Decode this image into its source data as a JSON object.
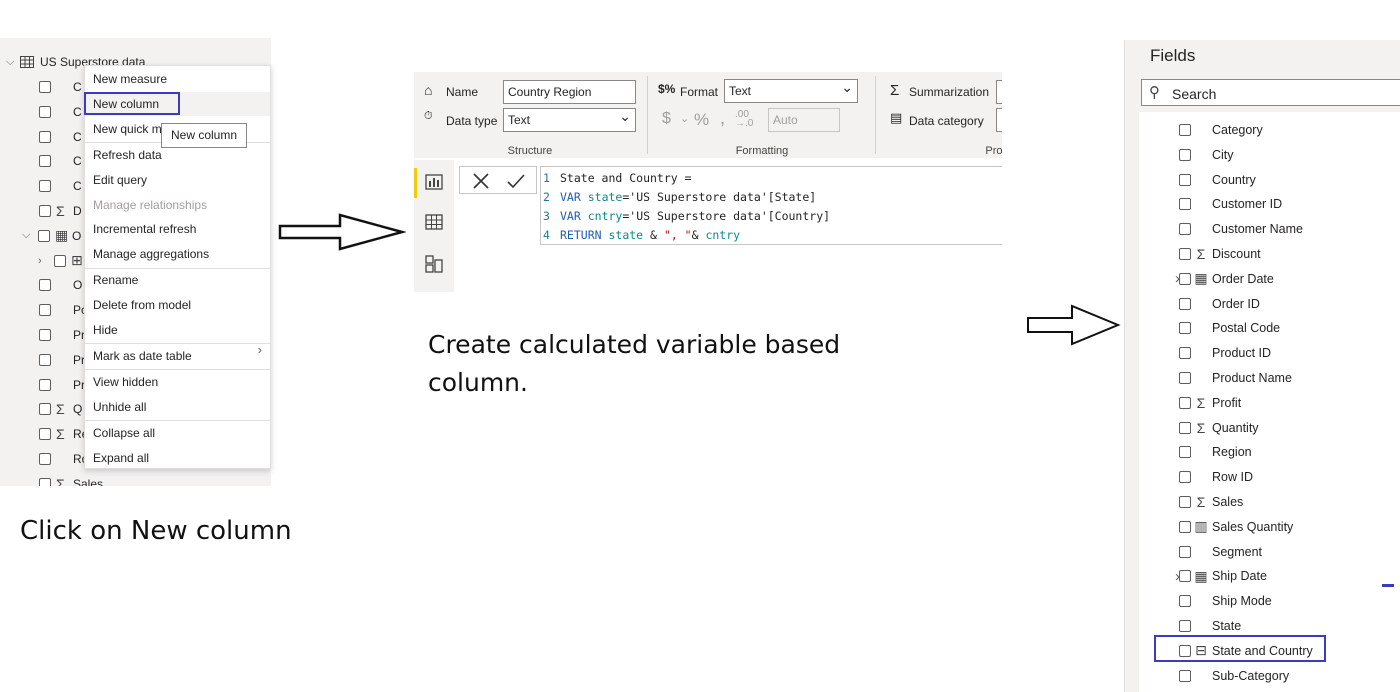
{
  "left_panel": {
    "table_name": "US Superstore data",
    "truncated_rows": [
      "C",
      "C",
      "C",
      "C",
      "C",
      "D",
      "O",
      "",
      "O",
      "Po",
      "Pr",
      "Pr",
      "Pr",
      "Q",
      "Re",
      "Ro",
      "Sales"
    ],
    "context_menu": {
      "items": [
        {
          "label": "New measure",
          "disabled": false
        },
        {
          "label": "New column",
          "disabled": false
        },
        {
          "label": "New quick m",
          "disabled": false
        },
        {
          "label": "Refresh data",
          "disabled": false
        },
        {
          "label": "Edit query",
          "disabled": false
        },
        {
          "label": "Manage relationships",
          "disabled": true
        },
        {
          "label": "Incremental refresh",
          "disabled": false
        },
        {
          "label": "Manage aggregations",
          "disabled": false
        },
        {
          "label": "Rename",
          "disabled": false
        },
        {
          "label": "Delete from model",
          "disabled": false
        },
        {
          "label": "Hide",
          "disabled": false
        },
        {
          "label": "Mark as date table",
          "disabled": false
        },
        {
          "label": "View hidden",
          "disabled": false
        },
        {
          "label": "Unhide all",
          "disabled": false
        },
        {
          "label": "Collapse all",
          "disabled": false
        },
        {
          "label": "Expand all",
          "disabled": false
        }
      ],
      "tooltip": "New column"
    },
    "caption": "Click on New column"
  },
  "ribbon": {
    "name_label": "Name",
    "name_value": "Country Region",
    "data_type_label": "Data type",
    "data_type_value": "Text",
    "structure_label": "Structure",
    "format_label": "Format",
    "format_value": "Text",
    "auto_value": "Auto",
    "formatting_label": "Formatting",
    "summarization_label": "Summarization",
    "data_category_label": "Data category",
    "properties_label": "Prop"
  },
  "formula": {
    "lines": [
      {
        "n": "1",
        "text": "State and Country ="
      },
      {
        "n": "2",
        "kw": "VAR",
        "var": "state",
        "rest": "='US Superstore data'[State]"
      },
      {
        "n": "3",
        "kw": "VAR",
        "var": "cntry",
        "rest": "='US Superstore data'[Country]"
      },
      {
        "n": "4",
        "kw": "RETURN",
        "var": "state",
        "amp1": " & ",
        "str": "\", \"",
        "amp2": "& ",
        "var2": "cntry"
      }
    ]
  },
  "caption_center": "Create calculated variable based column.",
  "fields_panel": {
    "title": "Fields",
    "search_placeholder": "Search",
    "fields": [
      {
        "label": "Category",
        "icon": "",
        "expandable": false
      },
      {
        "label": "City",
        "icon": "",
        "expandable": false
      },
      {
        "label": "Country",
        "icon": "",
        "expandable": false
      },
      {
        "label": "Customer ID",
        "icon": "",
        "expandable": false
      },
      {
        "label": "Customer Name",
        "icon": "",
        "expandable": false
      },
      {
        "label": "Discount",
        "icon": "sigma",
        "expandable": false
      },
      {
        "label": "Order Date",
        "icon": "calendar",
        "expandable": true
      },
      {
        "label": "Order ID",
        "icon": "",
        "expandable": false
      },
      {
        "label": "Postal Code",
        "icon": "",
        "expandable": false
      },
      {
        "label": "Product ID",
        "icon": "",
        "expandable": false
      },
      {
        "label": "Product Name",
        "icon": "",
        "expandable": false
      },
      {
        "label": "Profit",
        "icon": "sigma",
        "expandable": false
      },
      {
        "label": "Quantity",
        "icon": "sigma",
        "expandable": false
      },
      {
        "label": "Region",
        "icon": "",
        "expandable": false
      },
      {
        "label": "Row ID",
        "icon": "",
        "expandable": false
      },
      {
        "label": "Sales",
        "icon": "sigma",
        "expandable": false
      },
      {
        "label": "Sales Quantity",
        "icon": "calculator",
        "expandable": false
      },
      {
        "label": "Segment",
        "icon": "",
        "expandable": false
      },
      {
        "label": "Ship Date",
        "icon": "calendar",
        "expandable": true
      },
      {
        "label": "Ship Mode",
        "icon": "",
        "expandable": false
      },
      {
        "label": "State",
        "icon": "",
        "expandable": false
      },
      {
        "label": "State and Country",
        "icon": "calculated-column",
        "expandable": false
      },
      {
        "label": "Sub-Category",
        "icon": "",
        "expandable": false
      }
    ]
  },
  "colors": {
    "highlight": "#3b3bbd",
    "panel_bg": "#f3f2f1",
    "accent": "#f2c811"
  }
}
